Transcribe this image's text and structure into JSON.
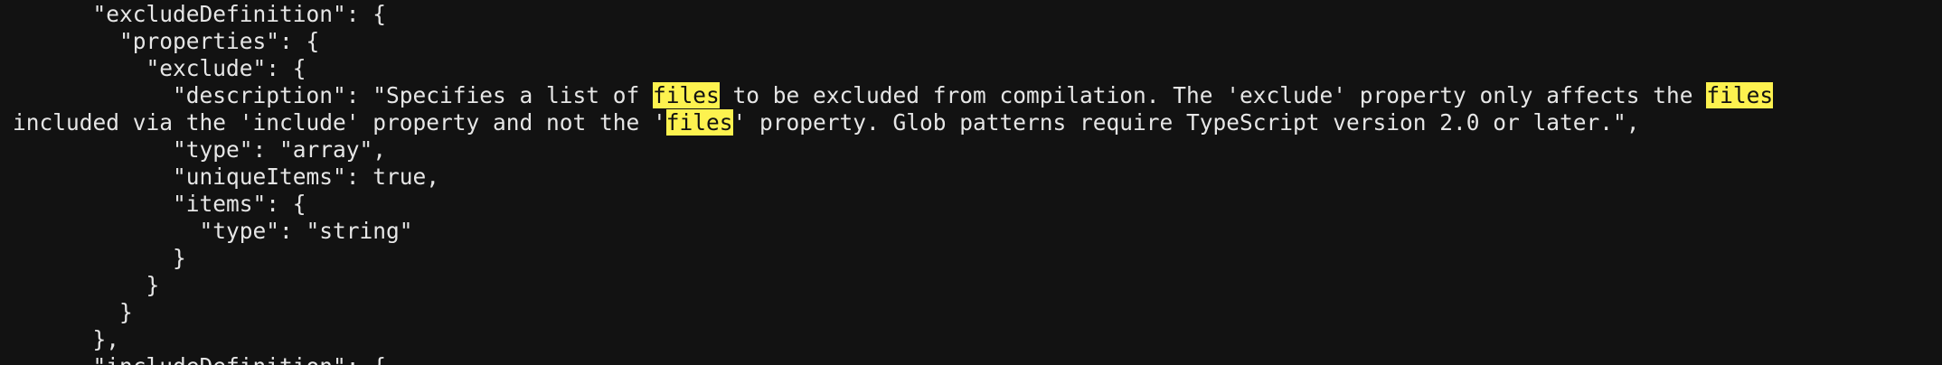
{
  "search": {
    "term": "files",
    "highlight_color": "#fdf24f"
  },
  "colors": {
    "background": "#121212",
    "text": "#e6e6e6"
  },
  "code_lines": [
    [
      {
        "t": "      \"excludeDefinition\": {"
      }
    ],
    [
      {
        "t": "        \"properties\": {"
      }
    ],
    [
      {
        "t": "          \"exclude\": {"
      }
    ],
    [
      {
        "t": "            \"description\": \"Specifies a list of "
      },
      {
        "t": "files",
        "hl": true
      },
      {
        "t": " to be excluded from compilation. The 'exclude' property only affects the "
      },
      {
        "t": "files",
        "hl": true
      }
    ],
    [
      {
        "t": "included via the 'include' property and not the '"
      },
      {
        "t": "files",
        "hl": true
      },
      {
        "t": "' property. Glob patterns require TypeScript version 2.0 or later.\","
      }
    ],
    [
      {
        "t": "            \"type\": \"array\","
      }
    ],
    [
      {
        "t": "            \"uniqueItems\": true,"
      }
    ],
    [
      {
        "t": "            \"items\": {"
      }
    ],
    [
      {
        "t": "              \"type\": \"string\""
      }
    ],
    [
      {
        "t": "            }"
      }
    ],
    [
      {
        "t": "          }"
      }
    ],
    [
      {
        "t": "        }"
      }
    ],
    [
      {
        "t": "      },"
      }
    ],
    [
      {
        "t": "      \"includeDefinition\": {"
      }
    ]
  ]
}
